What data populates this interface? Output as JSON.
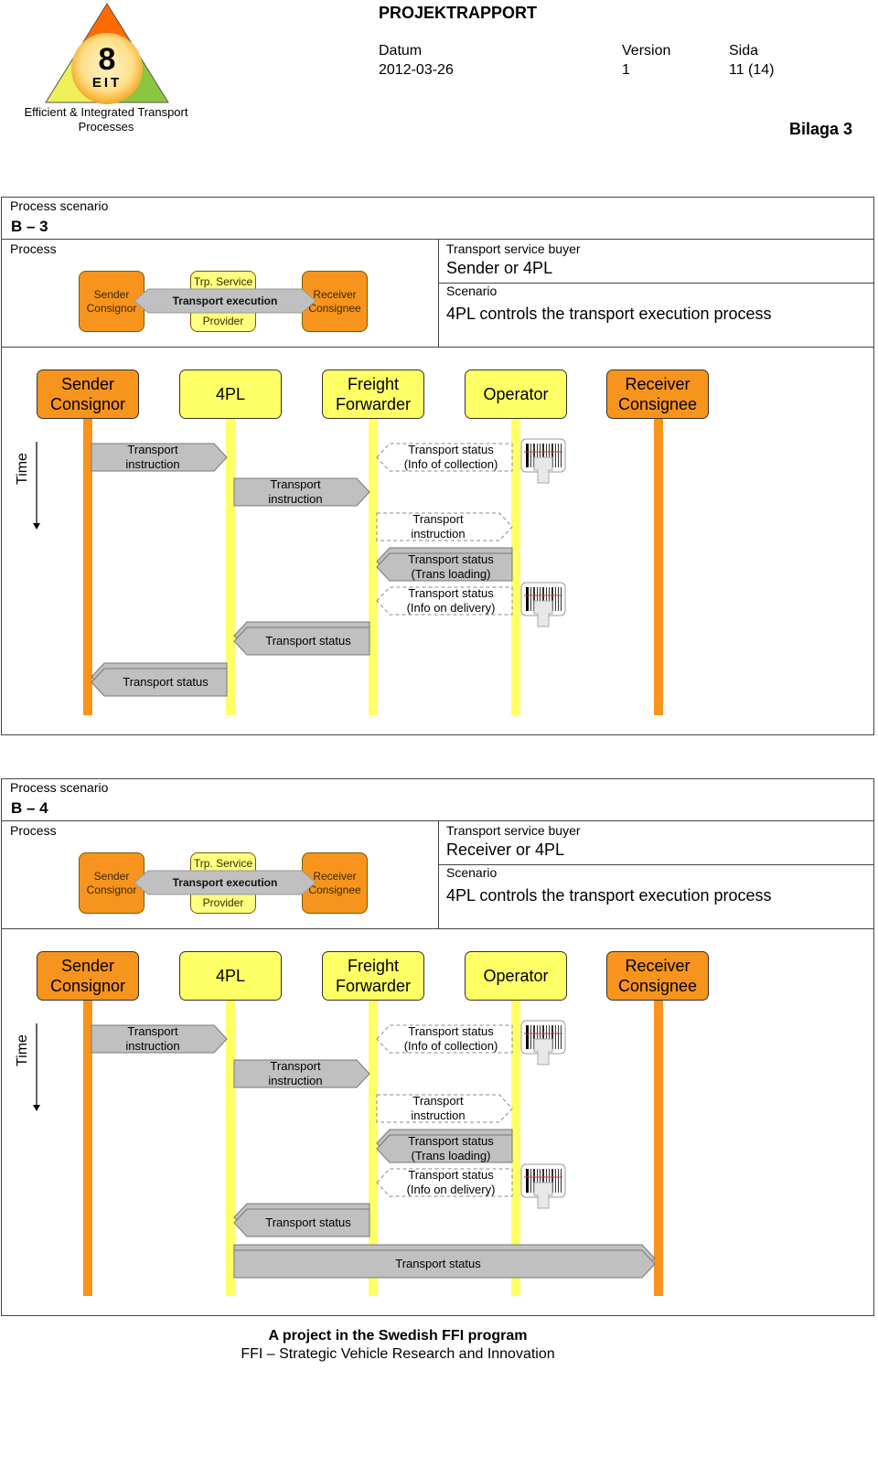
{
  "header": {
    "logo": {
      "number": "8",
      "letters": "EIT",
      "tagline_line1": "Efficient & Integrated Transport",
      "tagline_line2": "Processes"
    },
    "title": "PROJEKTRAPPORT",
    "datum_label": "Datum",
    "datum_value": "2012-03-26",
    "version_label": "Version",
    "version_value": "1",
    "sida_label": "Sida",
    "sida_value": "11 (14)",
    "bilaga": "Bilaga 3"
  },
  "colors": {
    "orange": "#f7941d",
    "yellow": "#ffff66",
    "arrow_gray": "#c0c0c0",
    "border": "#444444"
  },
  "scenarios": [
    {
      "label": "Process scenario",
      "id": "B – 3",
      "process_label": "Process",
      "process_diagram": {
        "left": "Sender Consignor",
        "center_top": "Trp. Service",
        "center_bottom": "Provider",
        "arrow": "Transport execution",
        "right": "Receiver Consignee"
      },
      "buyer_label": "Transport service buyer",
      "buyer_value": "Sender or 4PL",
      "scenario_label": "Scenario",
      "scenario_value": "4PL controls the transport execution process",
      "time_label": "Time",
      "actors": [
        {
          "line1": "Sender",
          "line2": "Consignor",
          "color": "orange"
        },
        {
          "line1": "4PL",
          "line2": "",
          "color": "yellow"
        },
        {
          "line1": "Freight",
          "line2": "Forwarder",
          "color": "yellow"
        },
        {
          "line1": "Operator",
          "line2": "",
          "color": "yellow"
        },
        {
          "line1": "Receiver",
          "line2": "Consignee",
          "color": "orange"
        }
      ],
      "messages": [
        {
          "from": 0,
          "to": 1,
          "line1": "Transport",
          "line2": "instruction",
          "style": "solid"
        },
        {
          "from": 3,
          "to": 2,
          "line1": "Transport status",
          "line2": "(Info of collection)",
          "style": "dashed",
          "scanner": true
        },
        {
          "from": 1,
          "to": 2,
          "line1": "Transport",
          "line2": "instruction",
          "style": "solid"
        },
        {
          "from": 2,
          "to": 3,
          "line1": "Transport",
          "line2": "instruction",
          "style": "dashed"
        },
        {
          "from": 3,
          "to": 2,
          "line1": "Transport status",
          "line2": "(Trans loading)",
          "style": "double"
        },
        {
          "from": 3,
          "to": 2,
          "line1": "Transport status",
          "line2": "(Info on delivery)",
          "style": "dashed",
          "scanner": true
        },
        {
          "from": 2,
          "to": 1,
          "line1": "Transport status",
          "line2": "",
          "style": "double"
        },
        {
          "from": 1,
          "to": 0,
          "line1": "Transport status",
          "line2": "",
          "style": "double"
        }
      ]
    },
    {
      "label": "Process scenario",
      "id": "B – 4",
      "process_label": "Process",
      "process_diagram": {
        "left": "Sender Consignor",
        "center_top": "Trp. Service",
        "center_bottom": "Provider",
        "arrow": "Transport execution",
        "right": "Receiver Consignee"
      },
      "buyer_label": "Transport service buyer",
      "buyer_value": "Receiver or 4PL",
      "scenario_label": "Scenario",
      "scenario_value": "4PL controls the transport execution process",
      "time_label": "Time",
      "actors": [
        {
          "line1": "Sender",
          "line2": "Consignor",
          "color": "orange"
        },
        {
          "line1": "4PL",
          "line2": "",
          "color": "yellow"
        },
        {
          "line1": "Freight",
          "line2": "Forwarder",
          "color": "yellow"
        },
        {
          "line1": "Operator",
          "line2": "",
          "color": "yellow"
        },
        {
          "line1": "Receiver",
          "line2": "Consignee",
          "color": "orange"
        }
      ],
      "messages": [
        {
          "from": 0,
          "to": 1,
          "line1": "Transport",
          "line2": "instruction",
          "style": "solid"
        },
        {
          "from": 3,
          "to": 2,
          "line1": "Transport status",
          "line2": "(Info of collection)",
          "style": "dashed",
          "scanner": true
        },
        {
          "from": 1,
          "to": 2,
          "line1": "Transport",
          "line2": "instruction",
          "style": "solid"
        },
        {
          "from": 2,
          "to": 3,
          "line1": "Transport",
          "line2": "instruction",
          "style": "dashed"
        },
        {
          "from": 3,
          "to": 2,
          "line1": "Transport status",
          "line2": "(Trans loading)",
          "style": "double"
        },
        {
          "from": 3,
          "to": 2,
          "line1": "Transport status",
          "line2": "(Info on delivery)",
          "style": "dashed",
          "scanner": true
        },
        {
          "from": 2,
          "to": 1,
          "line1": "Transport status",
          "line2": "",
          "style": "double"
        },
        {
          "from": 1,
          "to": 4,
          "line1": "Transport status",
          "line2": "",
          "style": "double"
        }
      ]
    }
  ],
  "footer": {
    "line1": "A project in the Swedish FFI program",
    "line2": "FFI – Strategic Vehicle Research and Innovation"
  }
}
